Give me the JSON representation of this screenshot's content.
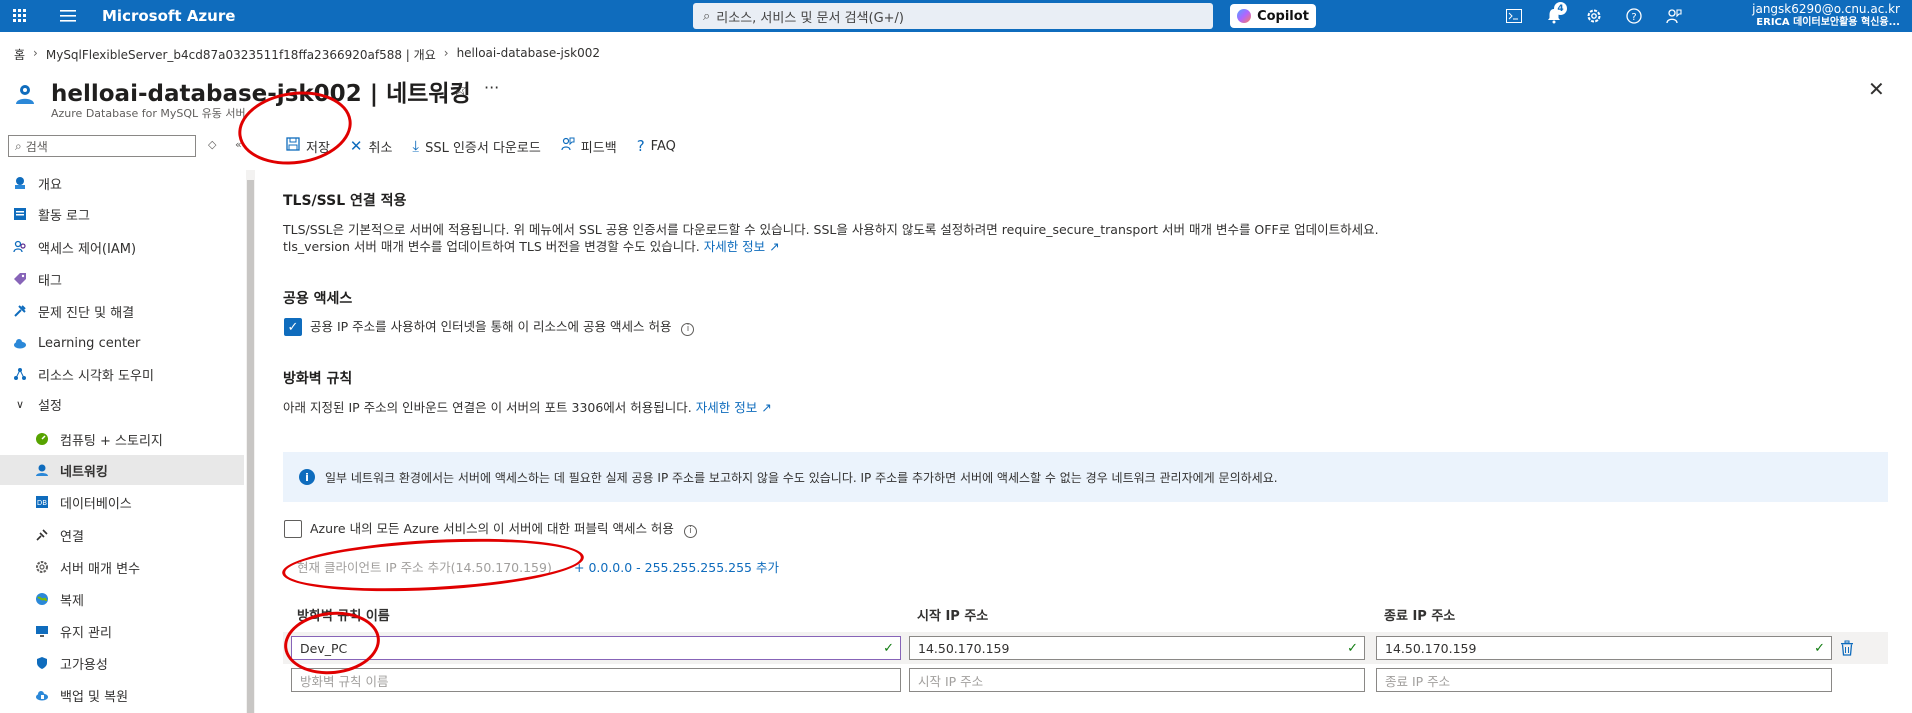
{
  "topbar": {
    "brand": "Microsoft Azure",
    "search_placeholder": "리소스, 서비스 및 문서 검색(G+/)",
    "copilot_label": "Copilot",
    "notification_count": "4",
    "account_email": "jangsk6290@o.cnu.ac.kr",
    "account_org": "ERICA 데이터보안활용 혁신융..."
  },
  "breadcrumb": {
    "home": "홈",
    "parent": "MySqlFlexibleServer_b4cd87a0323511f18ffa2366920af588 | 개요",
    "current": "helloai-database-jsk002"
  },
  "header": {
    "title": "helloai-database-jsk002 | 네트워킹",
    "subtitle": "Azure Database for MySQL 유동 서버"
  },
  "sidebar": {
    "search_placeholder": "검색",
    "items": [
      {
        "label": "개요",
        "icon": "mysql-icon"
      },
      {
        "label": "활동 로그",
        "icon": "log-icon"
      },
      {
        "label": "액세스 제어(IAM)",
        "icon": "people-icon"
      },
      {
        "label": "태그",
        "icon": "tag-icon"
      },
      {
        "label": "문제 진단 및 해결",
        "icon": "wrench-icon"
      },
      {
        "label": "Learning center",
        "icon": "cloud-icon"
      },
      {
        "label": "리소스 시각화 도우미",
        "icon": "graph-icon"
      },
      {
        "label": "설정",
        "icon": "chevron-down-icon"
      },
      {
        "label": "컴퓨팅 + 스토리지",
        "icon": "gauge-icon"
      },
      {
        "label": "네트워킹",
        "icon": "network-icon"
      },
      {
        "label": "데이터베이스",
        "icon": "database-icon"
      },
      {
        "label": "연결",
        "icon": "plug-icon"
      },
      {
        "label": "서버 매개 변수",
        "icon": "gear-icon"
      },
      {
        "label": "복제",
        "icon": "globe-icon"
      },
      {
        "label": "유지 관리",
        "icon": "monitor-icon"
      },
      {
        "label": "고가용성",
        "icon": "shield-icon"
      },
      {
        "label": "백업 및 복원",
        "icon": "backup-icon"
      }
    ]
  },
  "toolbar": {
    "save": "저장",
    "cancel": "취소",
    "ssl_download": "SSL 인증서 다운로드",
    "feedback": "피드백",
    "faq": "FAQ"
  },
  "tls": {
    "heading": "TLS/SSL 연결 적용",
    "line1": "TLS/SSL은 기본적으로 서버에 적용됩니다. 위 메뉴에서 SSL 공용 인증서를 다운로드할 수 있습니다. SSL을 사용하지 않도록 설정하려면 require_secure_transport 서버 매개 변수를 OFF로 업데이트하세요.",
    "line2": "tls_version 서버 매개 변수를 업데이트하여 TLS 버전을 변경할 수도 있습니다.",
    "link": "자세한 정보"
  },
  "public_access": {
    "heading": "공용 액세스",
    "checkbox_label": "공용 IP 주소를 사용하여 인터넷을 통해 이 리소스에 공용 액세스 허용",
    "checked": true
  },
  "firewall": {
    "heading": "방화벽 규칙",
    "desc": "아래 지정된 IP 주소의 인바운드 연결은 이 서버의 포트 3306에서 허용됩니다.",
    "link": "자세한 정보",
    "info": "일부 네트워크 환경에서는 서버에 액세스하는 데 필요한 실제 공용 IP 주소를 보고하지 않을 수도 있습니다. IP 주소를 추가하면 서버에 액세스할 수 없는 경우 네트워크 관리자에게 문의하세요.",
    "azure_checkbox": "Azure 내의 모든 Azure 서비스의 이 서버에 대한 퍼블릭 액세스 허용",
    "add_client_ip": "현재 클라이언트 IP 주소 추가(14.50.170.159)",
    "add_range": "+ 0.0.0.0 - 255.255.255.255 추가",
    "col_name": "방화벽 규칙 이름",
    "col_start": "시작 IP 주소",
    "col_end": "종료 IP 주소",
    "rows": [
      {
        "name": "Dev_PC",
        "start": "14.50.170.159",
        "end": "14.50.170.159"
      }
    ],
    "placeholder_name": "방화벽 규칙 이름",
    "placeholder_start": "시작 IP 주소",
    "placeholder_end": "종료 IP 주소"
  }
}
